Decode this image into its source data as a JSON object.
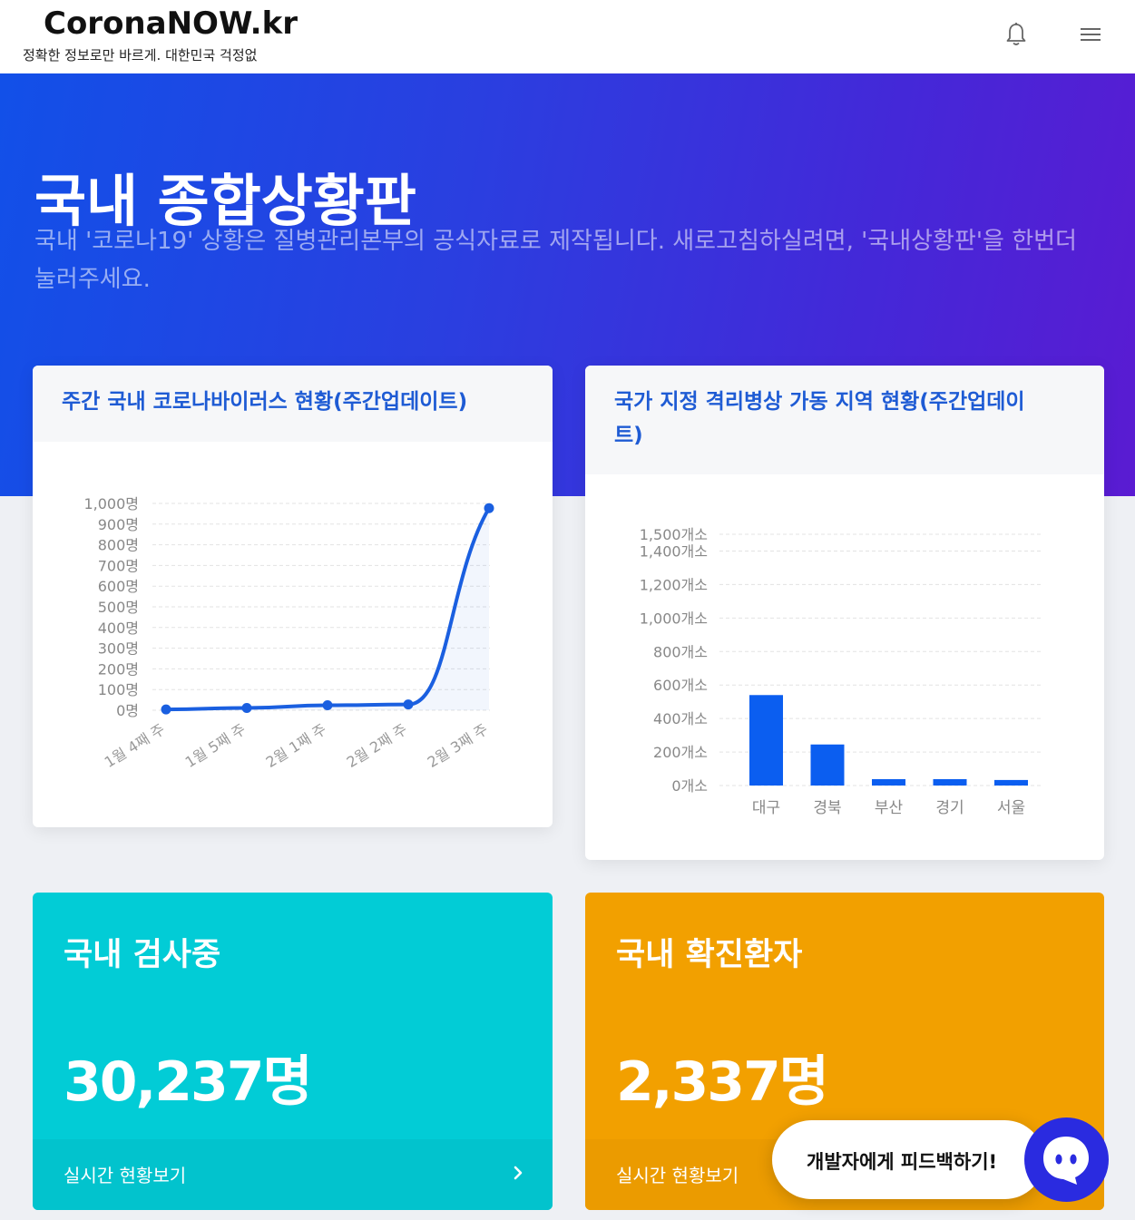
{
  "header": {
    "logo": "CoronaNOW.kr",
    "tagline": "정확한 정보로만 바르게. 대한민국 걱정없"
  },
  "hero": {
    "title": "국내 종합상황판",
    "description": "국내 '코로나19' 상황은 질병관리본부의 공식자료로 제작됩니다. 새로고침하실려면, '국내상황판'을 한번더 눌러주세요."
  },
  "weekly_card": {
    "title": "주간 국내 코로나바이러스 현황(주간업데이트)"
  },
  "hospital_card": {
    "title_line1": "국가 지정 격리병상 가동 지역 현황(주간업데이",
    "title_line2": "트)"
  },
  "chart_data": [
    {
      "type": "line",
      "categories": [
        "1월 4째 주",
        "1월 5째 주",
        "2월 1째 주",
        "2월 2째 주",
        "2월 3째 주"
      ],
      "values": [
        4,
        11,
        24,
        28,
        977
      ],
      "ylim": [
        0,
        1000
      ],
      "ytick_labels": [
        "0명",
        "100명",
        "200명",
        "300명",
        "400명",
        "500명",
        "600명",
        "700명",
        "800명",
        "900명",
        "1,000명"
      ],
      "area_fill": true,
      "color": "#1a5fe0"
    },
    {
      "type": "bar",
      "categories": [
        "대구",
        "경북",
        "부산",
        "경기",
        "서울"
      ],
      "values": [
        540,
        245,
        38,
        38,
        33
      ],
      "ylim": [
        0,
        1500
      ],
      "ytick_values": [
        0,
        200,
        400,
        600,
        800,
        1000,
        1200,
        1400,
        1500
      ],
      "ytick_labels": [
        "0개소",
        "200개소",
        "400개소",
        "600개소",
        "800개소",
        "1,000개소",
        "1,200개소",
        "1,400개소",
        "1,500개소"
      ],
      "color": "#0b5ef0"
    }
  ],
  "stats": [
    {
      "title": "국내 검사중",
      "value": "30,237명",
      "link": "실시간 현황보기",
      "color": "#02ccd6"
    },
    {
      "title": "국내 확진환자",
      "value": "2,337명",
      "link": "실시간 현황보기",
      "color": "#f2a000"
    }
  ],
  "feedback": {
    "label": "개발자에게 피드백하기!"
  },
  "icons": {
    "bell": "bell-icon",
    "menu": "menu-icon",
    "chevron": "chevron-right-icon",
    "chat": "chat-icon"
  }
}
